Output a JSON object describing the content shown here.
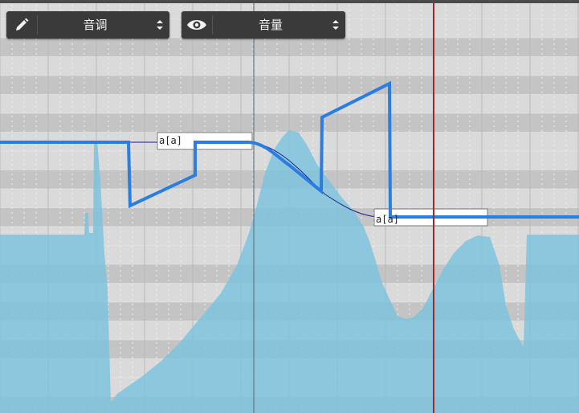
{
  "toolbar": {
    "param_select": {
      "icon": "pencil-icon",
      "value": "音调"
    },
    "view_select": {
      "icon": "eye-icon",
      "value": "音量"
    }
  },
  "notes": [
    {
      "lyric": "a[a]"
    },
    {
      "lyric": "a[a]"
    }
  ],
  "colors": {
    "grid_light": "#dadada",
    "grid_dark": "#c4c4c4",
    "waveform": "#7fc3de",
    "pitch_line": "#2a7de1",
    "base_pitch": "#1e1e8c",
    "playhead": "#9a2b2b",
    "toolbar_bg": "#3a3a3a"
  }
}
